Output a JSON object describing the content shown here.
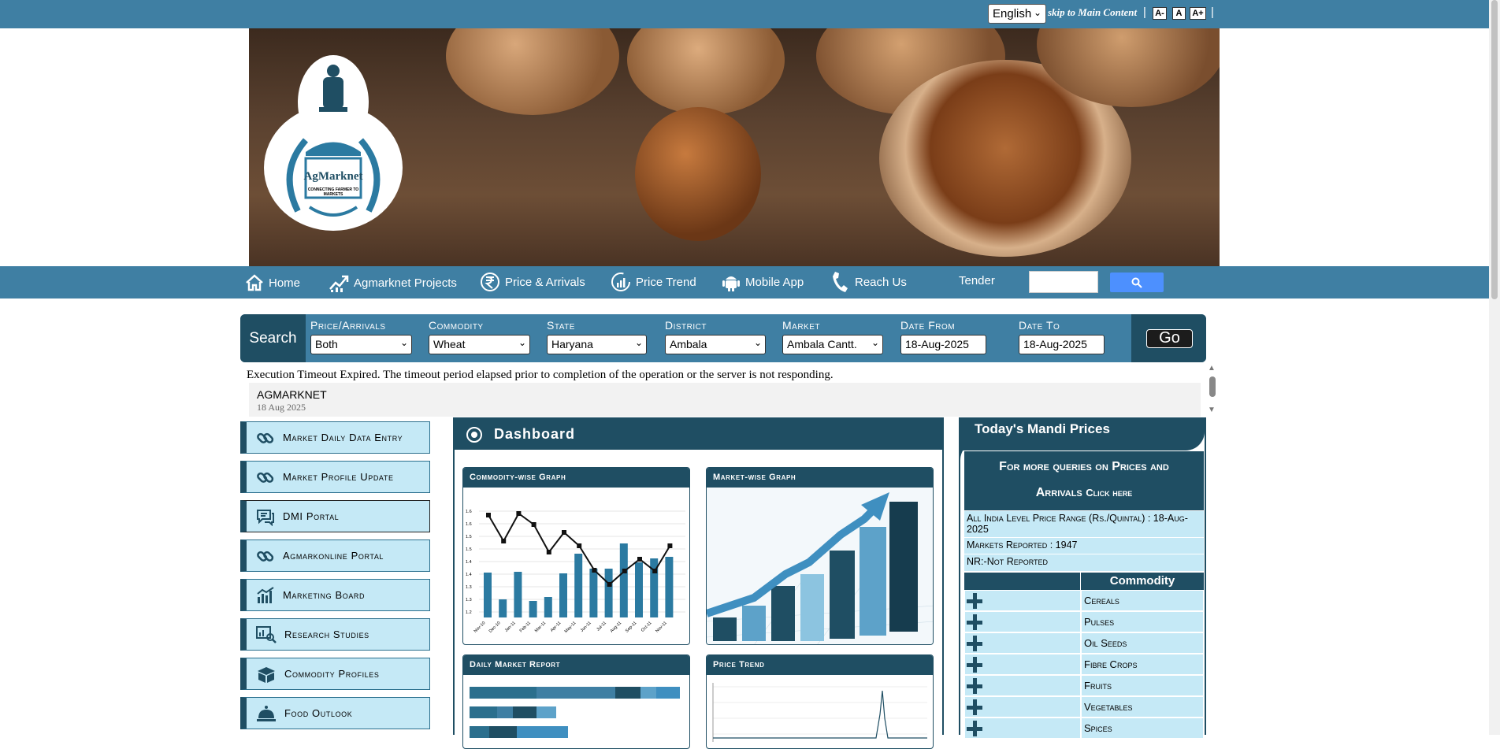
{
  "topbar": {
    "language": "English",
    "skip_link": "skip to Main Content",
    "font_small": "A-",
    "font_normal": "A",
    "font_large": "A+"
  },
  "brand": {
    "name": "AgMarknet",
    "tagline": "CONNECTING FARMER TO MARKETS"
  },
  "nav": {
    "items": [
      "Home",
      "Agmarknet Projects",
      "Price & Arrivals",
      "Price Trend",
      "Mobile App",
      "Reach Us",
      "Tender"
    ]
  },
  "search_panel": {
    "title": "Search",
    "fields": [
      {
        "label": "Price/Arrivals",
        "value": "Both"
      },
      {
        "label": "Commodity",
        "value": "Wheat"
      },
      {
        "label": "State",
        "value": "Haryana"
      },
      {
        "label": "District",
        "value": "Ambala"
      },
      {
        "label": "Market",
        "value": "Ambala Cantt."
      },
      {
        "label": "Date From",
        "value": "18-Aug-2025"
      },
      {
        "label": "Date To",
        "value": "18-Aug-2025"
      }
    ],
    "go": "Go"
  },
  "error_message": "Execution Timeout Expired. The timeout period elapsed prior to completion of the operation or the server is not responding.",
  "ticker": {
    "title": "AGMARKNET",
    "date": "18 Aug 2025"
  },
  "sidebar": {
    "items": [
      {
        "label": "Market Daily Data Entry",
        "icon": "link-icon"
      },
      {
        "label": "Market Profile Update",
        "icon": "link-icon"
      },
      {
        "label": "DMI Portal",
        "icon": "chat-icon"
      },
      {
        "label": "Agmarkonline Portal",
        "icon": "link-icon"
      },
      {
        "label": "Marketing Board",
        "icon": "bar-chart-icon"
      },
      {
        "label": "Research Studies",
        "icon": "research-icon"
      },
      {
        "label": "Commodity Profiles",
        "icon": "box-icon"
      },
      {
        "label": "Food Outlook",
        "icon": "food-icon"
      }
    ]
  },
  "dashboard": {
    "title": "Dashboard",
    "cards": [
      "Commodity-wise Graph",
      "Market-wise Graph",
      "Daily Market Report",
      "Price Trend"
    ],
    "commodity_graph": {
      "months": [
        "Nov-10",
        "Dec-10",
        "Jan-11",
        "Feb-11",
        "Mar-11",
        "Apr-11",
        "May-11",
        "Jun-11",
        "Jul-11",
        "Aug-11",
        "Sep-11",
        "Oct-11",
        "Nov-11"
      ],
      "yticks": [
        "1.6",
        "1.6",
        "1.5",
        "1.5",
        "1.4",
        "1.4",
        "1.3",
        "1.3",
        "1.2"
      ]
    }
  },
  "mandi": {
    "title": "Today's Mandi Prices",
    "queries_line1": "For more queries on Prices and",
    "queries_line2": "Arrivals",
    "click_here": "Click here",
    "price_range": "All India Level Price Range (Rs./Quintal) : 18-Aug-2025",
    "markets_reported": "Markets Reported : 1947",
    "nr_note": "NR:-Not Reported",
    "column_header": "Commodity",
    "commodities": [
      "Cereals",
      "Pulses",
      "Oil Seeds",
      "Fibre Crops",
      "Fruits",
      "Vegetables",
      "Spices"
    ]
  },
  "colors": {
    "primary": "#3f7fa3",
    "dark": "#1f4e63",
    "light": "#c5e9f6",
    "search_button": "#4d90fe"
  }
}
